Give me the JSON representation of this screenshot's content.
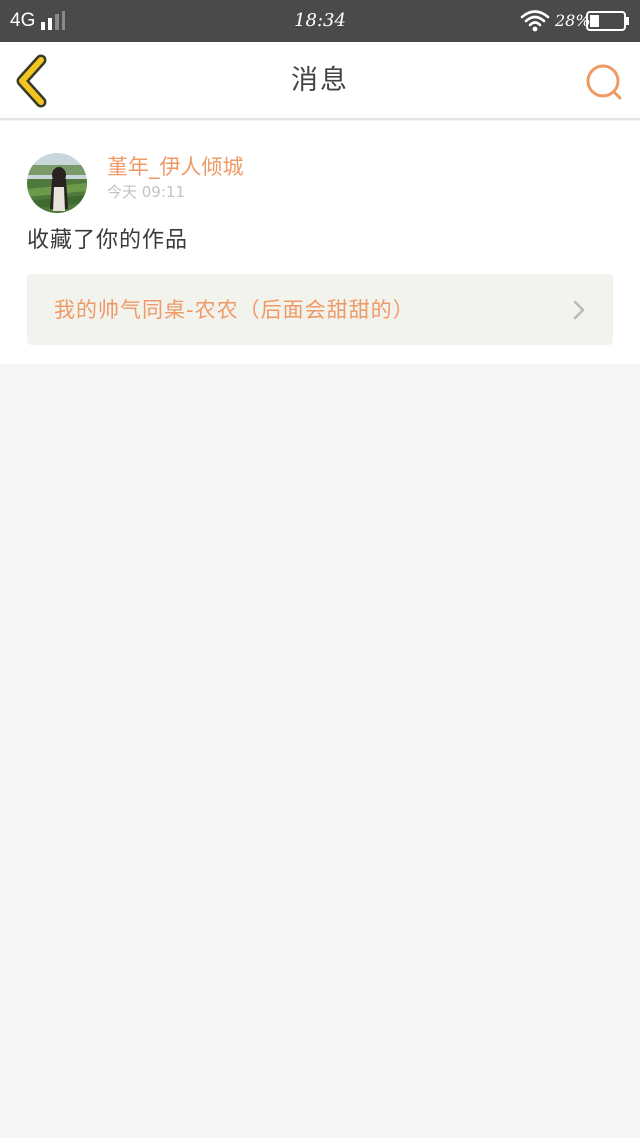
{
  "status_bar": {
    "network": "4G",
    "time": "18:34",
    "battery_percent": "28%",
    "battery_level": 0.28,
    "icons": [
      "signal-icon",
      "wifi-icon",
      "battery-icon"
    ]
  },
  "header": {
    "title": "消息",
    "back_icon": "chevron-left-icon",
    "search_icon": "search-icon"
  },
  "message": {
    "username": "堇年_伊人倾城",
    "timestamp": "今天 09:11",
    "action": "收藏了你的作品",
    "work_title": "我的帅气同桌-农农（后面会甜甜的）",
    "avatar_icon": "avatar-photo"
  },
  "colors": {
    "accent": "#ee9a67",
    "back_arrow": "#f2c521",
    "status_bar": "#4a4a4a",
    "background": "#f6f6f6"
  }
}
